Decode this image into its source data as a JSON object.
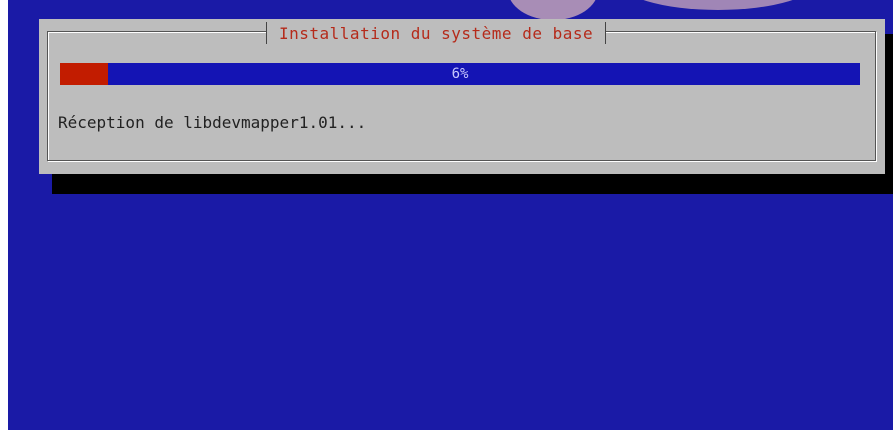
{
  "dialog": {
    "title": "Installation du système de base",
    "progress": {
      "percent": 6,
      "label": "6%"
    },
    "status": "Réception de libdevmapper1.01..."
  },
  "colors": {
    "screen_background": "#1a1aa6",
    "dialog_background": "#bdbdbd",
    "title_text": "#b52a1a",
    "progress_track": "#1414b4",
    "progress_fill": "#c21c00",
    "progress_label": "#c9c9ff"
  }
}
